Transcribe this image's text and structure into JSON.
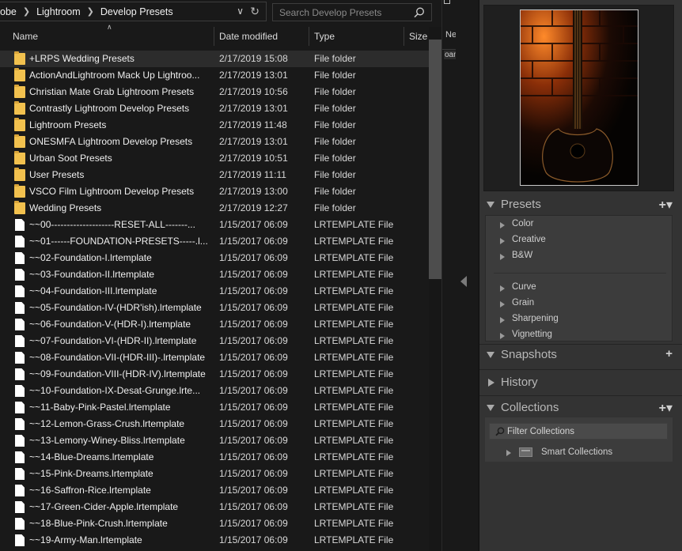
{
  "explorer": {
    "breadcrumb": [
      "obe",
      "Lightroom",
      "Develop Presets"
    ],
    "search_placeholder": "Search Develop Presets",
    "columns": {
      "name": "Name",
      "date": "Date modified",
      "type": "Type",
      "size": "Size"
    },
    "rows": [
      {
        "name": "+LRPS Wedding Presets",
        "date": "2/17/2019 15:08",
        "type": "File folder",
        "kind": "folder",
        "selected": true
      },
      {
        "name": "ActionAndLightroom Mack Up Lightroo...",
        "date": "2/17/2019 13:01",
        "type": "File folder",
        "kind": "folder"
      },
      {
        "name": "Christian Mate Grab Lightroom Presets",
        "date": "2/17/2019 10:56",
        "type": "File folder",
        "kind": "folder"
      },
      {
        "name": "Contrastly Lightroom Develop Presets",
        "date": "2/17/2019 13:01",
        "type": "File folder",
        "kind": "folder"
      },
      {
        "name": "Lightroom Presets",
        "date": "2/17/2019 11:48",
        "type": "File folder",
        "kind": "folder"
      },
      {
        "name": "ONESMFA Lightroom Develop Presets",
        "date": "2/17/2019 13:01",
        "type": "File folder",
        "kind": "folder"
      },
      {
        "name": "Urban Soot Presets",
        "date": "2/17/2019 10:51",
        "type": "File folder",
        "kind": "folder"
      },
      {
        "name": "User Presets",
        "date": "2/17/2019 11:11",
        "type": "File folder",
        "kind": "folder"
      },
      {
        "name": "VSCO Film Lightroom Develop Presets",
        "date": "2/17/2019 13:00",
        "type": "File folder",
        "kind": "folder"
      },
      {
        "name": "Wedding Presets",
        "date": "2/17/2019 12:27",
        "type": "File folder",
        "kind": "folder"
      },
      {
        "name": "~~00--------------------RESET-ALL-------...",
        "date": "1/15/2017 06:09",
        "type": "LRTEMPLATE File",
        "kind": "file"
      },
      {
        "name": "~~01------FOUNDATION-PRESETS-----.l...",
        "date": "1/15/2017 06:09",
        "type": "LRTEMPLATE File",
        "kind": "file"
      },
      {
        "name": "~~02-Foundation-I.lrtemplate",
        "date": "1/15/2017 06:09",
        "type": "LRTEMPLATE File",
        "kind": "file"
      },
      {
        "name": "~~03-Foundation-II.lrtemplate",
        "date": "1/15/2017 06:09",
        "type": "LRTEMPLATE File",
        "kind": "file"
      },
      {
        "name": "~~04-Foundation-III.lrtemplate",
        "date": "1/15/2017 06:09",
        "type": "LRTEMPLATE File",
        "kind": "file"
      },
      {
        "name": "~~05-Foundation-IV-(HDR'ish).lrtemplate",
        "date": "1/15/2017 06:09",
        "type": "LRTEMPLATE File",
        "kind": "file"
      },
      {
        "name": "~~06-Foundation-V-(HDR-I).lrtemplate",
        "date": "1/15/2017 06:09",
        "type": "LRTEMPLATE File",
        "kind": "file"
      },
      {
        "name": "~~07-Foundation-VI-(HDR-II).lrtemplate",
        "date": "1/15/2017 06:09",
        "type": "LRTEMPLATE File",
        "kind": "file"
      },
      {
        "name": "~~08-Foundation-VII-(HDR-III)-.lrtemplate",
        "date": "1/15/2017 06:09",
        "type": "LRTEMPLATE File",
        "kind": "file"
      },
      {
        "name": "~~09-Foundation-VIII-(HDR-IV).lrtemplate",
        "date": "1/15/2017 06:09",
        "type": "LRTEMPLATE File",
        "kind": "file"
      },
      {
        "name": "~~10-Foundation-IX-Desat-Grunge.lrte...",
        "date": "1/15/2017 06:09",
        "type": "LRTEMPLATE File",
        "kind": "file"
      },
      {
        "name": "~~11-Baby-Pink-Pastel.lrtemplate",
        "date": "1/15/2017 06:09",
        "type": "LRTEMPLATE File",
        "kind": "file"
      },
      {
        "name": "~~12-Lemon-Grass-Crush.lrtemplate",
        "date": "1/15/2017 06:09",
        "type": "LRTEMPLATE File",
        "kind": "file"
      },
      {
        "name": "~~13-Lemony-Winey-Bliss.lrtemplate",
        "date": "1/15/2017 06:09",
        "type": "LRTEMPLATE File",
        "kind": "file"
      },
      {
        "name": "~~14-Blue-Dreams.lrtemplate",
        "date": "1/15/2017 06:09",
        "type": "LRTEMPLATE File",
        "kind": "file"
      },
      {
        "name": "~~15-Pink-Dreams.lrtemplate",
        "date": "1/15/2017 06:09",
        "type": "LRTEMPLATE File",
        "kind": "file"
      },
      {
        "name": "~~16-Saffron-Rice.lrtemplate",
        "date": "1/15/2017 06:09",
        "type": "LRTEMPLATE File",
        "kind": "file"
      },
      {
        "name": "~~17-Green-Cider-Apple.lrtemplate",
        "date": "1/15/2017 06:09",
        "type": "LRTEMPLATE File",
        "kind": "file"
      },
      {
        "name": "~~18-Blue-Pink-Crush.lrtemplate",
        "date": "1/15/2017 06:09",
        "type": "LRTEMPLATE File",
        "kind": "file"
      },
      {
        "name": "~~19-Army-Man.lrtemplate",
        "date": "1/15/2017 06:09",
        "type": "LRTEMPLATE File",
        "kind": "file"
      }
    ]
  },
  "side_strip": {
    "new_label": "Ne",
    "item_label": "oam"
  },
  "lightroom": {
    "presets": {
      "title": "Presets",
      "group1": [
        "Color",
        "Creative",
        "B&W"
      ],
      "group2": [
        "Curve",
        "Grain",
        "Sharpening",
        "Vignetting"
      ]
    },
    "snapshots": {
      "title": "Snapshots"
    },
    "history": {
      "title": "History"
    },
    "collections": {
      "title": "Collections",
      "filter_placeholder": "Filter Collections",
      "smart_collections": "Smart Collections"
    }
  },
  "colors": {
    "folder": "#f2c14e",
    "panel": "#333333",
    "explorer_bg": "#191919"
  }
}
